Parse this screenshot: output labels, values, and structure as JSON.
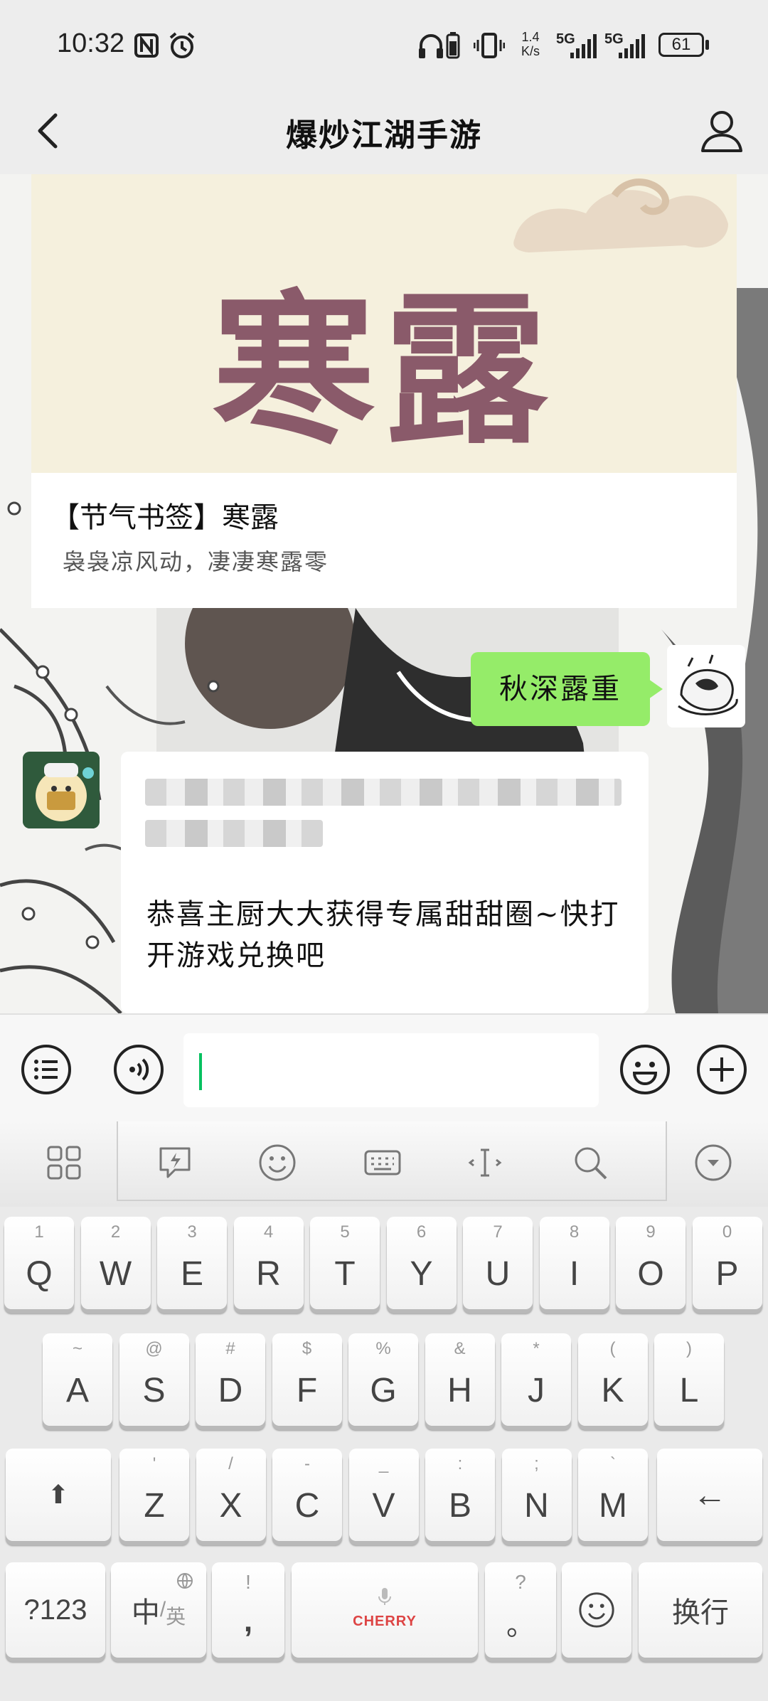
{
  "status_bar": {
    "time": "10:32",
    "network_speed": "1.4\nK/s",
    "net_speed_value": "1.4",
    "net_speed_unit": "K/s",
    "signal_1": "5G",
    "signal_2": "5G",
    "battery": "61"
  },
  "header": {
    "title": "爆炒江湖手游",
    "back_icon": "chevron-left-icon",
    "profile_icon": "person-icon"
  },
  "messages": {
    "article": {
      "banner_text": "寒露",
      "title": "【节气书签】寒露",
      "subtitle": "袅袅凉风动，凄凄寒露零"
    },
    "my_message": "秋深露重",
    "bot_message": "恭喜主厨大大获得专属甜甜圈~快打开游戏兑换吧"
  },
  "input_bar": {
    "menu_icon": "list-icon",
    "voice_icon": "voice-icon",
    "emoji_icon": "smiley-icon",
    "plus_icon": "plus-icon",
    "value": ""
  },
  "keyboard": {
    "brand": "CHERRY",
    "toolbar": [
      "apps-grid-icon",
      "flash-icon",
      "emoji-icon",
      "keyboard-icon",
      "cursor-icon",
      "search-icon",
      "collapse-icon"
    ],
    "row1": [
      {
        "main": "Q",
        "sub": "1"
      },
      {
        "main": "W",
        "sub": "2"
      },
      {
        "main": "E",
        "sub": "3"
      },
      {
        "main": "R",
        "sub": "4"
      },
      {
        "main": "T",
        "sub": "5"
      },
      {
        "main": "Y",
        "sub": "6"
      },
      {
        "main": "U",
        "sub": "7"
      },
      {
        "main": "I",
        "sub": "8"
      },
      {
        "main": "O",
        "sub": "9"
      },
      {
        "main": "P",
        "sub": "0"
      }
    ],
    "row2": [
      {
        "main": "A",
        "sub": "~"
      },
      {
        "main": "S",
        "sub": "@"
      },
      {
        "main": "D",
        "sub": "#"
      },
      {
        "main": "F",
        "sub": "$"
      },
      {
        "main": "G",
        "sub": "%"
      },
      {
        "main": "H",
        "sub": "&"
      },
      {
        "main": "J",
        "sub": "*"
      },
      {
        "main": "K",
        "sub": "("
      },
      {
        "main": "L",
        "sub": ")"
      }
    ],
    "row3": [
      {
        "main": "Z",
        "sub": "'"
      },
      {
        "main": "X",
        "sub": "/"
      },
      {
        "main": "C",
        "sub": "-"
      },
      {
        "main": "V",
        "sub": "_"
      },
      {
        "main": "B",
        "sub": ":"
      },
      {
        "main": "N",
        "sub": ";"
      },
      {
        "main": "M",
        "sub": "`"
      }
    ],
    "shift": "⬆",
    "backspace": "←",
    "num_key": "?123",
    "lang_key_main": "中",
    "lang_key_sub": "英",
    "comma_main": ",",
    "comma_sub": "!",
    "period_main": "。",
    "period_sub": "?",
    "enter": "换行"
  }
}
